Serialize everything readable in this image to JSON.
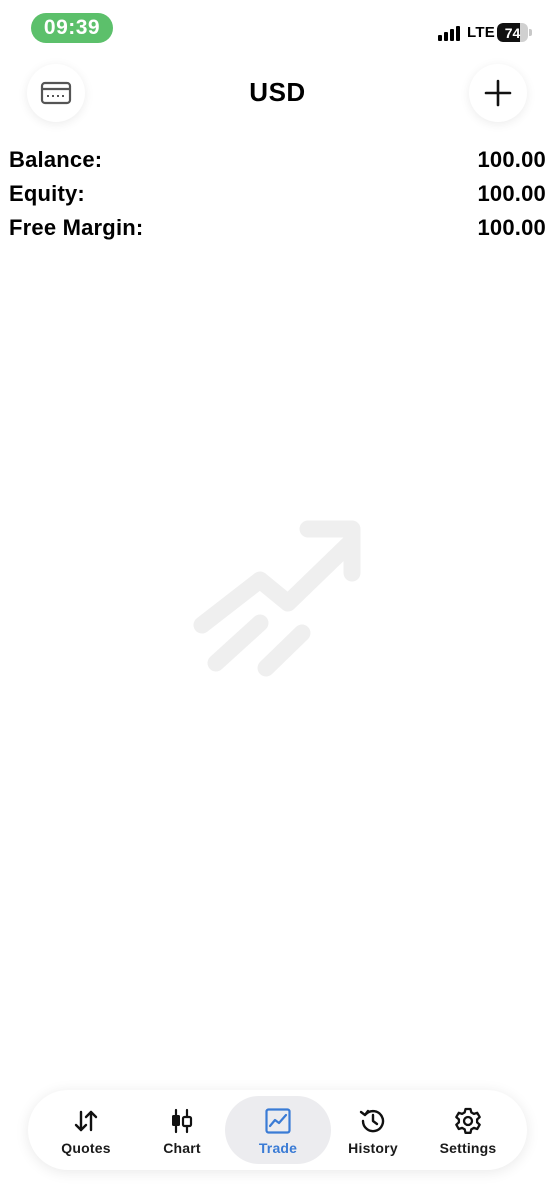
{
  "status_bar": {
    "time": "09:39",
    "network": "LTE",
    "battery_level": "74",
    "battery_fraction": 0.74
  },
  "header": {
    "title": "USD",
    "left_icon": "card-icon",
    "right_icon": "plus-icon"
  },
  "account": {
    "rows": [
      {
        "label": "Balance:",
        "value": "100.00"
      },
      {
        "label": "Equity:",
        "value": "100.00"
      },
      {
        "label": "Free Margin:",
        "value": "100.00"
      }
    ]
  },
  "empty_state": {
    "icon": "trending-up-icon"
  },
  "tabs": [
    {
      "label": "Quotes",
      "icon": "arrows-up-down-icon",
      "active": false
    },
    {
      "label": "Chart",
      "icon": "candlestick-icon",
      "active": false
    },
    {
      "label": "Trade",
      "icon": "trade-chart-icon",
      "active": true
    },
    {
      "label": "History",
      "icon": "history-icon",
      "active": false
    },
    {
      "label": "Settings",
      "icon": "gear-icon",
      "active": false
    }
  ],
  "colors": {
    "time_pill": "#5cc06b",
    "active_tab_text": "#3a7bd5",
    "active_tab_bg": "#ececef",
    "illustration": "#efefef"
  }
}
